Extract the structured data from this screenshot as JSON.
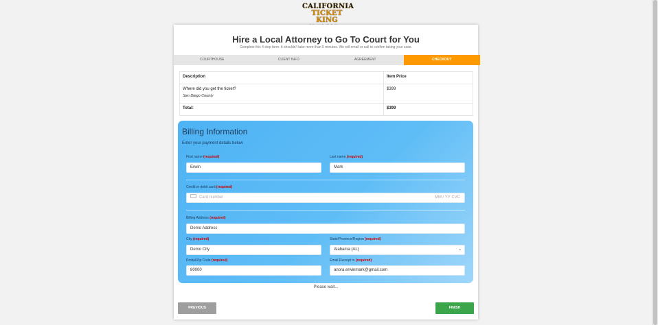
{
  "logo": {
    "line1": "CALIFORNIA",
    "line2": "TICKET KING",
    "tagline": "California's Best Traffic Attorneys"
  },
  "header": {
    "title": "Hire a Local Attorney to Go To Court for You",
    "subtitle": "Complete this 4 step form. It shouldn't take more than 5 minutes. We will email or call to confirm taking your case."
  },
  "steps": [
    {
      "label": "COURTHOUSE",
      "active": false
    },
    {
      "label": "CLIENT INFO",
      "active": false
    },
    {
      "label": "AGREEMENT",
      "active": false
    },
    {
      "label": "CHECKOUT",
      "active": true
    }
  ],
  "order": {
    "col_description": "Description",
    "col_price": "Item Price",
    "item_question": "Where did you get the ticket?",
    "item_location": "San Diego County",
    "item_price": "$399",
    "total_label": "Total:",
    "total_value": "$399"
  },
  "billing": {
    "title": "Billing Information",
    "subtitle": "Enter your payment details below",
    "required_text": "(required)",
    "first_name_label": "First name",
    "first_name_value": "Erwin",
    "last_name_label": "Last name",
    "last_name_value": "Mark",
    "card_label": "Credit or debit card",
    "card_placeholder": "Card number",
    "card_meta": "MM / YY  CVC",
    "address_label": "Billing Address",
    "address_value": "Demo Address",
    "city_label": "City",
    "city_value": "Demo City",
    "state_label": "State/Province/Region",
    "state_value": "Alabama (AL)",
    "zip_label": "Postal/Zip Code",
    "zip_value": "80000",
    "email_label": "Email Receipt to",
    "email_value": "anora.erwinmark@gmail.com"
  },
  "status": {
    "wait_text": "Please wait..."
  },
  "buttons": {
    "previous": "PREVIOUS",
    "finish": "FINISH"
  },
  "colors": {
    "accent": "#ff9900",
    "finish": "#3aa54b",
    "previous": "#9e9e9e",
    "billing_bg": "#5fbdf6",
    "required": "#d00000"
  }
}
